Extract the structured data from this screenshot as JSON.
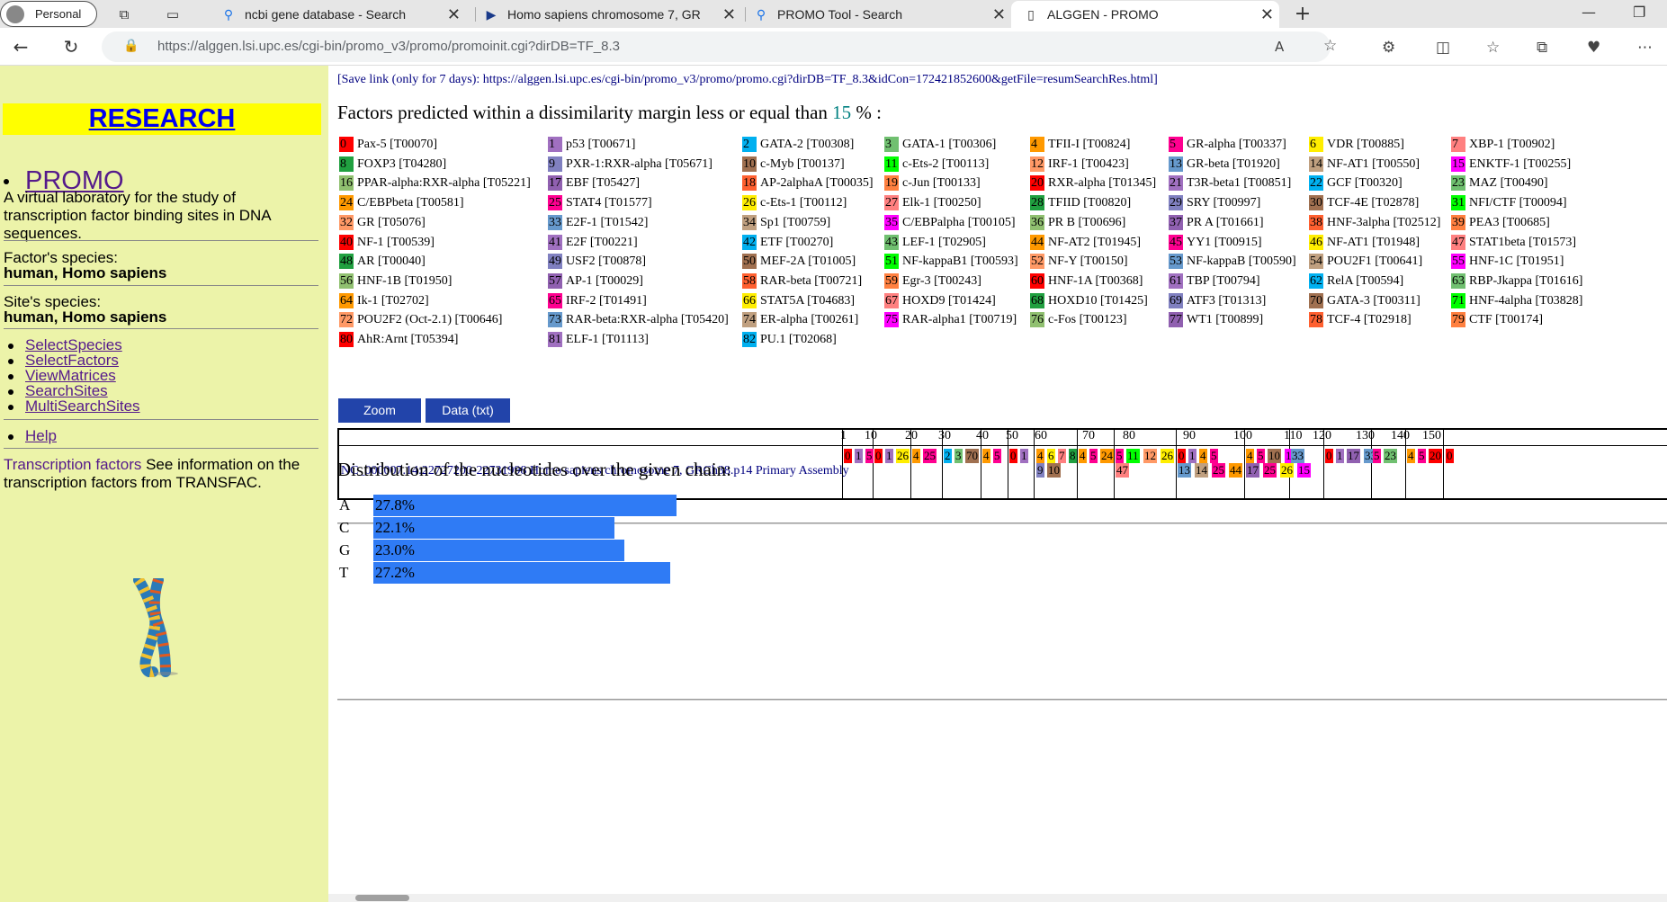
{
  "browser": {
    "profile": "Personal",
    "tabs": [
      {
        "title": "ncbi gene database - Search",
        "icon": "search-icon"
      },
      {
        "title": "Homo sapiens chromosome 7, GR",
        "icon": "ncbi-icon"
      },
      {
        "title": "PROMO Tool - Search",
        "icon": "search-icon"
      },
      {
        "title": "ALGGEN - PROMO",
        "icon": "page-icon"
      }
    ],
    "url": "https://alggen.lsi.upc.es/cgi-bin/promo_v3/promo/promoinit.cgi?dirDB=TF_8.3"
  },
  "sidebar": {
    "research": "RESEARCH",
    "promo": "PROMO",
    "description": "A virtual laboratory for the study of transcription factor binding sites in DNA sequences.",
    "factor_species_label": "Factor's species:",
    "factor_species": "human, Homo sapiens",
    "site_species_label": "Site's species:",
    "site_species": "human, Homo sapiens",
    "links": [
      "SelectSpecies",
      "SelectFactors",
      "ViewMatrices",
      "SearchSites",
      "MultiSearchSites"
    ],
    "help": "Help",
    "tf_link": "Transcription factors",
    "tf_text": " See information on the transcription factors from TRANSFAC."
  },
  "main": {
    "save_link": "[Save link (only for 7 days): https://alggen.lsi.upc.es/cgi-bin/promo_v3/promo/promo.cgi?dirDB=TF_8.3&idCon=172421852600&getFile=resumSearchRes.html]",
    "factors_head_pre": "Factors predicted within a dissimilarity margin less or equal than ",
    "factors_head_pct": "15",
    "factors_head_post": " % :",
    "factors": [
      [
        "0",
        "Pax-5 [T00070]",
        "#ff0000"
      ],
      [
        "1",
        "p53 [T00671]",
        "#a070c0"
      ],
      [
        "2",
        "GATA-2 [T00308]",
        "#00b0f0"
      ],
      [
        "3",
        "GATA-1 [T00306]",
        "#70c070"
      ],
      [
        "4",
        "TFII-I [T00824]",
        "#ff9900"
      ],
      [
        "5",
        "GR-alpha [T00337]",
        "#ff0090"
      ],
      [
        "6",
        "VDR [T00885]",
        "#ffee00"
      ],
      [
        "7",
        "XBP-1 [T00902]",
        "#ff8080"
      ],
      [
        "8",
        "FOXP3 [T04280]",
        "#20a040"
      ],
      [
        "9",
        "PXR-1:RXR-alpha [T05671]",
        "#8080c0"
      ],
      [
        "10",
        "c-Myb [T00137]",
        "#a07050"
      ],
      [
        "11",
        "c-Ets-2 [T00113]",
        "#00ff00"
      ],
      [
        "12",
        "IRF-1 [T00423]",
        "#ff9966"
      ],
      [
        "13",
        "GR-beta [T01920]",
        "#6699cc"
      ],
      [
        "14",
        "NF-AT1 [T00550]",
        "#c0a080"
      ],
      [
        "15",
        "ENKTF-1 [T00255]",
        "#ff00ff"
      ],
      [
        "16",
        "PPAR-alpha:RXR-alpha [T05221]",
        "#90c070"
      ],
      [
        "17",
        "EBF [T05427]",
        "#9060b0"
      ],
      [
        "18",
        "AP-2alphaA [T00035]",
        "#ff6030"
      ],
      [
        "19",
        "c-Jun [T00133]",
        "#ff8040"
      ],
      [
        "20",
        "RXR-alpha [T01345]",
        "#ff0000"
      ],
      [
        "21",
        "T3R-beta1 [T00851]",
        "#a070c0"
      ],
      [
        "22",
        "GCF [T00320]",
        "#00b0f0"
      ],
      [
        "23",
        "MAZ [T00490]",
        "#70c070"
      ],
      [
        "24",
        "C/EBPbeta [T00581]",
        "#ff9900"
      ],
      [
        "25",
        "STAT4 [T01577]",
        "#ff0090"
      ],
      [
        "26",
        "c-Ets-1 [T00112]",
        "#ffee00"
      ],
      [
        "27",
        "Elk-1 [T00250]",
        "#ff8080"
      ],
      [
        "28",
        "TFIID [T00820]",
        "#20a040"
      ],
      [
        "29",
        "SRY [T00997]",
        "#8080c0"
      ],
      [
        "30",
        "TCF-4E [T02878]",
        "#a07050"
      ],
      [
        "31",
        "NFI/CTF [T00094]",
        "#00ff00"
      ],
      [
        "32",
        "GR [T05076]",
        "#ff9966"
      ],
      [
        "33",
        "E2F-1 [T01542]",
        "#6699cc"
      ],
      [
        "34",
        "Sp1 [T00759]",
        "#c0a080"
      ],
      [
        "35",
        "C/EBPalpha [T00105]",
        "#ff00ff"
      ],
      [
        "36",
        "PR B [T00696]",
        "#90c070"
      ],
      [
        "37",
        "PR A [T01661]",
        "#9060b0"
      ],
      [
        "38",
        "HNF-3alpha [T02512]",
        "#ff6030"
      ],
      [
        "39",
        "PEA3 [T00685]",
        "#ff8040"
      ],
      [
        "40",
        "NF-1 [T00539]",
        "#ff0000"
      ],
      [
        "41",
        "E2F [T00221]",
        "#a070c0"
      ],
      [
        "42",
        "ETF [T00270]",
        "#00b0f0"
      ],
      [
        "43",
        "LEF-1 [T02905]",
        "#70c070"
      ],
      [
        "44",
        "NF-AT2 [T01945]",
        "#ff9900"
      ],
      [
        "45",
        "YY1 [T00915]",
        "#ff0090"
      ],
      [
        "46",
        "NF-AT1 [T01948]",
        "#ffee00"
      ],
      [
        "47",
        "STAT1beta [T01573]",
        "#ff8080"
      ],
      [
        "48",
        "AR [T00040]",
        "#20a040"
      ],
      [
        "49",
        "USF2 [T00878]",
        "#8080c0"
      ],
      [
        "50",
        "MEF-2A [T01005]",
        "#a07050"
      ],
      [
        "51",
        "NF-kappaB1 [T00593]",
        "#00ff00"
      ],
      [
        "52",
        "NF-Y [T00150]",
        "#ff9966"
      ],
      [
        "53",
        "NF-kappaB [T00590]",
        "#6699cc"
      ],
      [
        "54",
        "POU2F1 [T00641]",
        "#c0a080"
      ],
      [
        "55",
        "HNF-1C [T01951]",
        "#ff00ff"
      ],
      [
        "56",
        "HNF-1B [T01950]",
        "#90c070"
      ],
      [
        "57",
        "AP-1 [T00029]",
        "#9060b0"
      ],
      [
        "58",
        "RAR-beta [T00721]",
        "#ff6030"
      ],
      [
        "59",
        "Egr-3 [T00243]",
        "#ff8040"
      ],
      [
        "60",
        "HNF-1A [T00368]",
        "#ff0000"
      ],
      [
        "61",
        "TBP [T00794]",
        "#a070c0"
      ],
      [
        "62",
        "RelA [T00594]",
        "#00b0f0"
      ],
      [
        "63",
        "RBP-Jkappa [T01616]",
        "#70c070"
      ],
      [
        "64",
        "Ik-1 [T02702]",
        "#ff9900"
      ],
      [
        "65",
        "IRF-2 [T01491]",
        "#ff0090"
      ],
      [
        "66",
        "STAT5A [T04683]",
        "#ffee00"
      ],
      [
        "67",
        "HOXD9 [T01424]",
        "#ff8080"
      ],
      [
        "68",
        "HOXD10 [T01425]",
        "#20a040"
      ],
      [
        "69",
        "ATF3 [T01313]",
        "#8080c0"
      ],
      [
        "70",
        "GATA-3 [T00311]",
        "#a07050"
      ],
      [
        "71",
        "HNF-4alpha [T03828]",
        "#00ff00"
      ],
      [
        "72",
        "POU2F2 (Oct-2.1) [T00646]",
        "#ff9966"
      ],
      [
        "73",
        "RAR-beta:RXR-alpha [T05420]",
        "#6699cc"
      ],
      [
        "74",
        "ER-alpha [T00261]",
        "#c0a080"
      ],
      [
        "75",
        "RAR-alpha1 [T00719]",
        "#ff00ff"
      ],
      [
        "76",
        "c-Fos [T00123]",
        "#90c070"
      ],
      [
        "77",
        "WT1 [T00899]",
        "#9060b0"
      ],
      [
        "78",
        "TCF-4 [T02918]",
        "#ff6030"
      ],
      [
        "79",
        "CTF [T00174]",
        "#ff8040"
      ],
      [
        "80",
        "AhR:Arnt [T05394]",
        "#ff0000"
      ],
      [
        "81",
        "ELF-1 [T01113]",
        "#a070c0"
      ],
      [
        "82",
        "PU.1 [T02068]",
        "#00b0f0"
      ]
    ],
    "buttons": {
      "zoom": "Zoom",
      "data": "Data (txt)"
    },
    "ticks": [
      "1",
      "10",
      "20",
      "30",
      "40",
      "50",
      "60",
      "70",
      "80",
      "90",
      "100",
      "110",
      "120",
      "130",
      "140",
      "150"
    ],
    "seq_name": "NC_000007.14:22727200-22731998 Homo sapiens chromosome 7, GRCh38.p14 Primary Assembly",
    "marks": [
      [
        "0",
        "#ff0000",
        0
      ],
      [
        "1",
        "#a070c0",
        0
      ],
      [
        "5",
        "#ff0090",
        0
      ],
      [
        "0",
        "#ff0000",
        0
      ],
      [
        "1",
        "#a070c0",
        0
      ],
      [
        "26",
        "#ffee00",
        0
      ],
      [
        "4",
        "#ff9900",
        0
      ],
      [
        "25",
        "#ff0090",
        0
      ],
      [
        "2",
        "#00b0f0",
        0
      ],
      [
        "3",
        "#70c070",
        0
      ],
      [
        "70",
        "#a07050",
        0
      ],
      [
        "4",
        "#ff9900",
        0
      ],
      [
        "5",
        "#ff0090",
        0
      ],
      [
        "0",
        "#ff0000",
        0
      ],
      [
        "1",
        "#a070c0",
        0
      ],
      [
        "4",
        "#ff9900",
        0
      ],
      [
        "6",
        "#ffee00",
        0
      ],
      [
        "7",
        "#ff8080",
        0
      ],
      [
        "8",
        "#20a040",
        0
      ],
      [
        "9",
        "#8080c0",
        1
      ],
      [
        "10",
        "#a07050",
        1
      ],
      [
        "4",
        "#ff9900",
        0
      ],
      [
        "5",
        "#ff0090",
        0
      ],
      [
        "24",
        "#ff9900",
        0
      ],
      [
        "5",
        "#ff0090",
        0
      ],
      [
        "11",
        "#00ff00",
        0
      ],
      [
        "12",
        "#ff9966",
        0
      ],
      [
        "26",
        "#ffee00",
        0
      ],
      [
        "47",
        "#ff8080",
        1
      ],
      [
        "0",
        "#ff0000",
        0
      ],
      [
        "1",
        "#a070c0",
        0
      ],
      [
        "4",
        "#ff9900",
        0
      ],
      [
        "5",
        "#ff0090",
        0
      ],
      [
        "13",
        "#6699cc",
        1
      ],
      [
        "14",
        "#c0a080",
        1
      ],
      [
        "25",
        "#ff0090",
        1
      ],
      [
        "44",
        "#ff9900",
        1
      ],
      [
        "4",
        "#ff9900",
        0
      ],
      [
        "5",
        "#ff0090",
        0
      ],
      [
        "10",
        "#a07050",
        0
      ],
      [
        "15",
        "#ff00ff",
        0
      ],
      [
        "17",
        "#9060b0",
        1
      ],
      [
        "25",
        "#ff0090",
        1
      ],
      [
        "26",
        "#ffee00",
        1
      ],
      [
        "33",
        "#6699cc",
        0
      ],
      [
        "0",
        "#ff0000",
        0
      ],
      [
        "1",
        "#a070c0",
        0
      ],
      [
        "17",
        "#9060b0",
        0
      ],
      [
        "33",
        "#6699cc",
        0
      ],
      [
        "5",
        "#ff0090",
        0
      ],
      [
        "23",
        "#70c070",
        0
      ],
      [
        "4",
        "#ff9900",
        0
      ],
      [
        "5",
        "#ff0090",
        0
      ],
      [
        "20",
        "#ff0000",
        0
      ],
      [
        "0",
        "#ff0000",
        0
      ],
      [
        "15",
        "#ff00ff",
        1
      ]
    ],
    "dist_head": "Distribution of the nucleotides over the given chain:",
    "nucleotides": [
      {
        "base": "A",
        "label": "27.8%",
        "value": 27.8
      },
      {
        "base": "C",
        "label": "22.1%",
        "value": 22.1
      },
      {
        "base": "G",
        "label": "23.0%",
        "value": 23.0
      },
      {
        "base": "T",
        "label": "27.2%",
        "value": 27.2
      }
    ]
  }
}
